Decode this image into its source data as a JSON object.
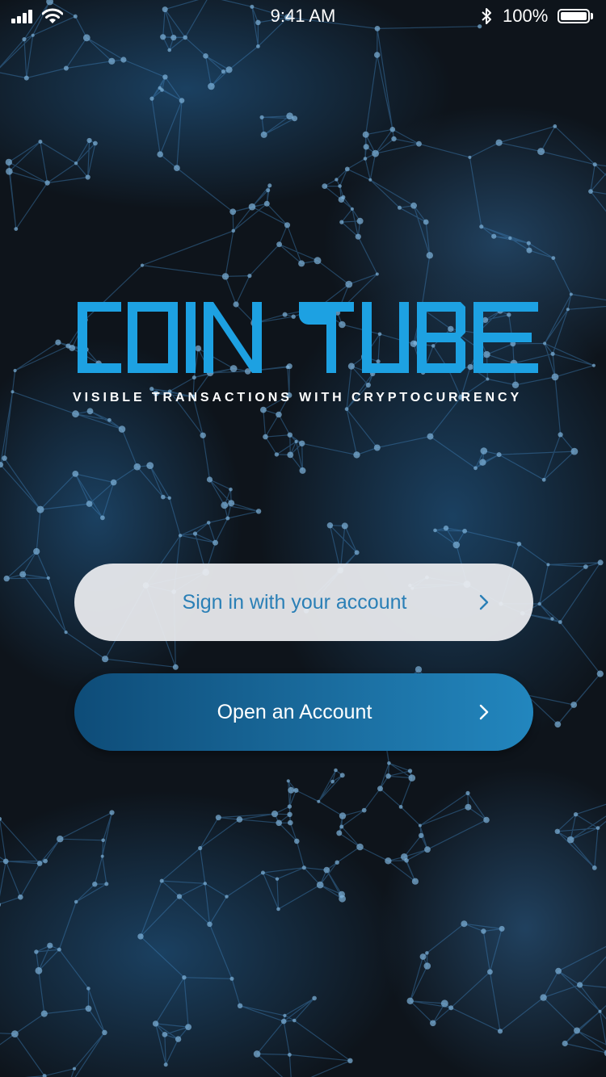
{
  "status_bar": {
    "time": "9:41 AM",
    "battery_percent": "100%",
    "battery_level": 1.0,
    "icons": [
      "signal-icon",
      "wifi-icon",
      "bluetooth-icon",
      "battery-icon"
    ]
  },
  "brand": {
    "logo_text": "COIN TUBE",
    "tagline": "VISIBLE TRANSACTIONS WITH CRYPTOCURRENCY",
    "color": "#1da1e2"
  },
  "buttons": {
    "sign_in": {
      "label": "Sign in with your account",
      "icon": "chevron-right-icon"
    },
    "open_account": {
      "label": "Open an Account",
      "icon": "chevron-right-icon"
    }
  },
  "colors": {
    "background": "#0d1218",
    "network": "#3f7fb6",
    "sign_in_bg": "#ecedf0",
    "sign_in_text": "#2a7fb6",
    "open_gradient_start": "#0e4c78",
    "open_gradient_end": "#2286be"
  }
}
